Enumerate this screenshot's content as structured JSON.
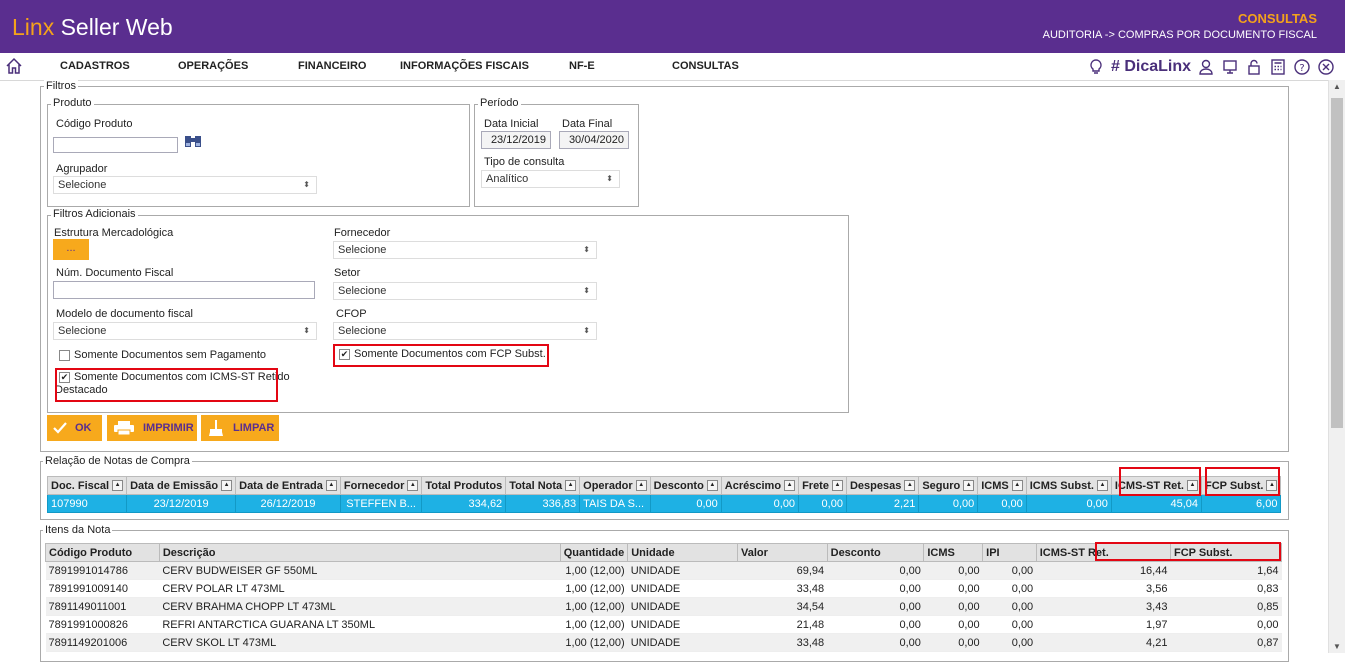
{
  "header": {
    "brand_linx": "Linx",
    "brand_rest": "Seller Web",
    "section": "CONSULTAS",
    "breadcrumb": "AUDITORIA -> COMPRAS POR DOCUMENTO FISCAL"
  },
  "menu": [
    "CADASTROS",
    "OPERAÇÕES",
    "FINANCEIRO",
    "INFORMAÇÕES FISCAIS",
    "NF-E",
    "CONSULTAS"
  ],
  "toolbar": {
    "dica": "# DicaLinx"
  },
  "filtros": {
    "legend": "Filtros",
    "produto": {
      "legend": "Produto",
      "codigo_label": "Código Produto",
      "codigo_value": "",
      "agrupador_label": "Agrupador",
      "agrupador_value": "Selecione"
    },
    "periodo": {
      "legend": "Período",
      "inicial_label": "Data Inicial",
      "inicial_value": "23/12/2019",
      "final_label": "Data Final",
      "final_value": "30/04/2020",
      "tipo_label": "Tipo de consulta",
      "tipo_value": "Analítico"
    },
    "adicionais": {
      "legend": "Filtros Adicionais",
      "estrutura_label": "Estrutura Mercadológica",
      "estrutura_btn": "...",
      "num_doc_label": "Núm. Documento Fiscal",
      "num_doc_value": "",
      "modelo_label": "Modelo de documento fiscal",
      "modelo_value": "Selecione",
      "fornecedor_label": "Fornecedor",
      "fornecedor_value": "Selecione",
      "setor_label": "Setor",
      "setor_value": "Selecione",
      "cfop_label": "CFOP",
      "cfop_value": "Selecione",
      "chk_sem_pagamento": "Somente Documentos sem Pagamento",
      "chk_icms_st_line1": "Somente Documentos com ICMS-ST Retido",
      "chk_icms_st_line2": "Destacado",
      "chk_fcp": "Somente Documentos com FCP Subst."
    },
    "buttons": {
      "ok": "OK",
      "imprimir": "IMPRIMIR",
      "limpar": "LIMPAR"
    }
  },
  "relacao": {
    "legend": "Relação de Notas de Compra",
    "columns": [
      "Doc. Fiscal",
      "Data de Emissão",
      "Data de Entrada",
      "Fornecedor",
      "Total Produtos",
      "Total Nota",
      "Operador",
      "Desconto",
      "Acréscimo",
      "Frete",
      "Despesas",
      "Seguro",
      "ICMS",
      "ICMS Subst.",
      "ICMS-ST Ret.",
      "FCP Subst."
    ],
    "rows": [
      [
        "107990",
        "23/12/2019",
        "26/12/2019",
        "STEFFEN B...",
        "334,62",
        "336,83",
        "TAIS DA S...",
        "0,00",
        "0,00",
        "0,00",
        "2,21",
        "0,00",
        "0,00",
        "0,00",
        "45,04",
        "6,00"
      ]
    ]
  },
  "itens": {
    "legend": "Itens da Nota",
    "columns": [
      "Código Produto",
      "Descrição",
      "Quantidade",
      "Unidade",
      "Valor",
      "Desconto",
      "ICMS",
      "IPI",
      "ICMS-ST Ret.",
      "FCP Subst."
    ],
    "rows": [
      [
        "7891991014786",
        "CERV BUDWEISER GF 550ML",
        "1,00 (12,00)",
        "UNIDADE",
        "69,94",
        "0,00",
        "0,00",
        "0,00",
        "16,44",
        "1,64"
      ],
      [
        "7891991009140",
        "CERV POLAR LT 473ML",
        "1,00 (12,00)",
        "UNIDADE",
        "33,48",
        "0,00",
        "0,00",
        "0,00",
        "3,56",
        "0,83"
      ],
      [
        "7891149011001",
        "CERV BRAHMA CHOPP LT 473ML",
        "1,00 (12,00)",
        "UNIDADE",
        "34,54",
        "0,00",
        "0,00",
        "0,00",
        "3,43",
        "0,85"
      ],
      [
        "7891991000826",
        "REFRI ANTARCTICA GUARANA LT 350ML",
        "1,00 (12,00)",
        "UNIDADE",
        "21,48",
        "0,00",
        "0,00",
        "0,00",
        "1,97",
        "0,00"
      ],
      [
        "7891149201006",
        "CERV SKOL LT 473ML",
        "1,00 (12,00)",
        "UNIDADE",
        "33,48",
        "0,00",
        "0,00",
        "0,00",
        "4,21",
        "0,87"
      ]
    ]
  }
}
